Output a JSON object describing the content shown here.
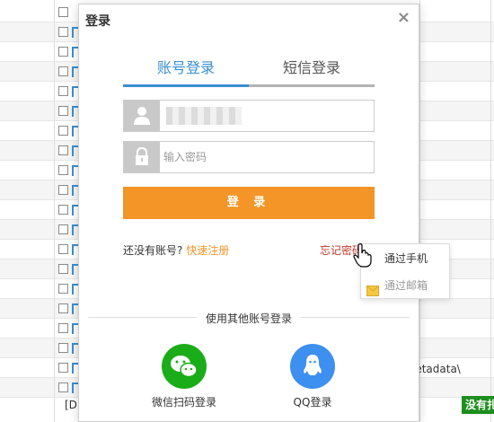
{
  "background": {
    "partial_text_1": "[D",
    "partial_text_2": "letadata\\",
    "status_badge": "没有扎"
  },
  "modal": {
    "title": "登录",
    "close_label": "×",
    "tabs": [
      {
        "label": "账号登录",
        "active": true
      },
      {
        "label": "短信登录",
        "active": false
      }
    ],
    "username": {
      "value": "",
      "placeholder": ""
    },
    "password": {
      "value": "",
      "placeholder": "输入密码"
    },
    "login_button": "登 录",
    "register_prompt": "还没有账号?",
    "register_link": "快速注册",
    "forgot_password": "忘记密码",
    "other_login_label": "使用其他账号登录",
    "social": [
      {
        "label": "微信扫码登录",
        "icon": "wechat-icon",
        "color": "#1aad19"
      },
      {
        "label": "QQ登录",
        "icon": "qq-icon",
        "color": "#3d8ff0"
      }
    ]
  },
  "forgot_menu": {
    "items": [
      {
        "label": "通过手机",
        "icon": "phone-icon",
        "enabled": true
      },
      {
        "label": "通过邮箱",
        "icon": "mail-icon",
        "enabled": false
      }
    ]
  },
  "colors": {
    "accent": "#3a8fd0",
    "login_button": "#f39527",
    "forgot_link": "#c0392b",
    "register_link": "#f39527"
  }
}
